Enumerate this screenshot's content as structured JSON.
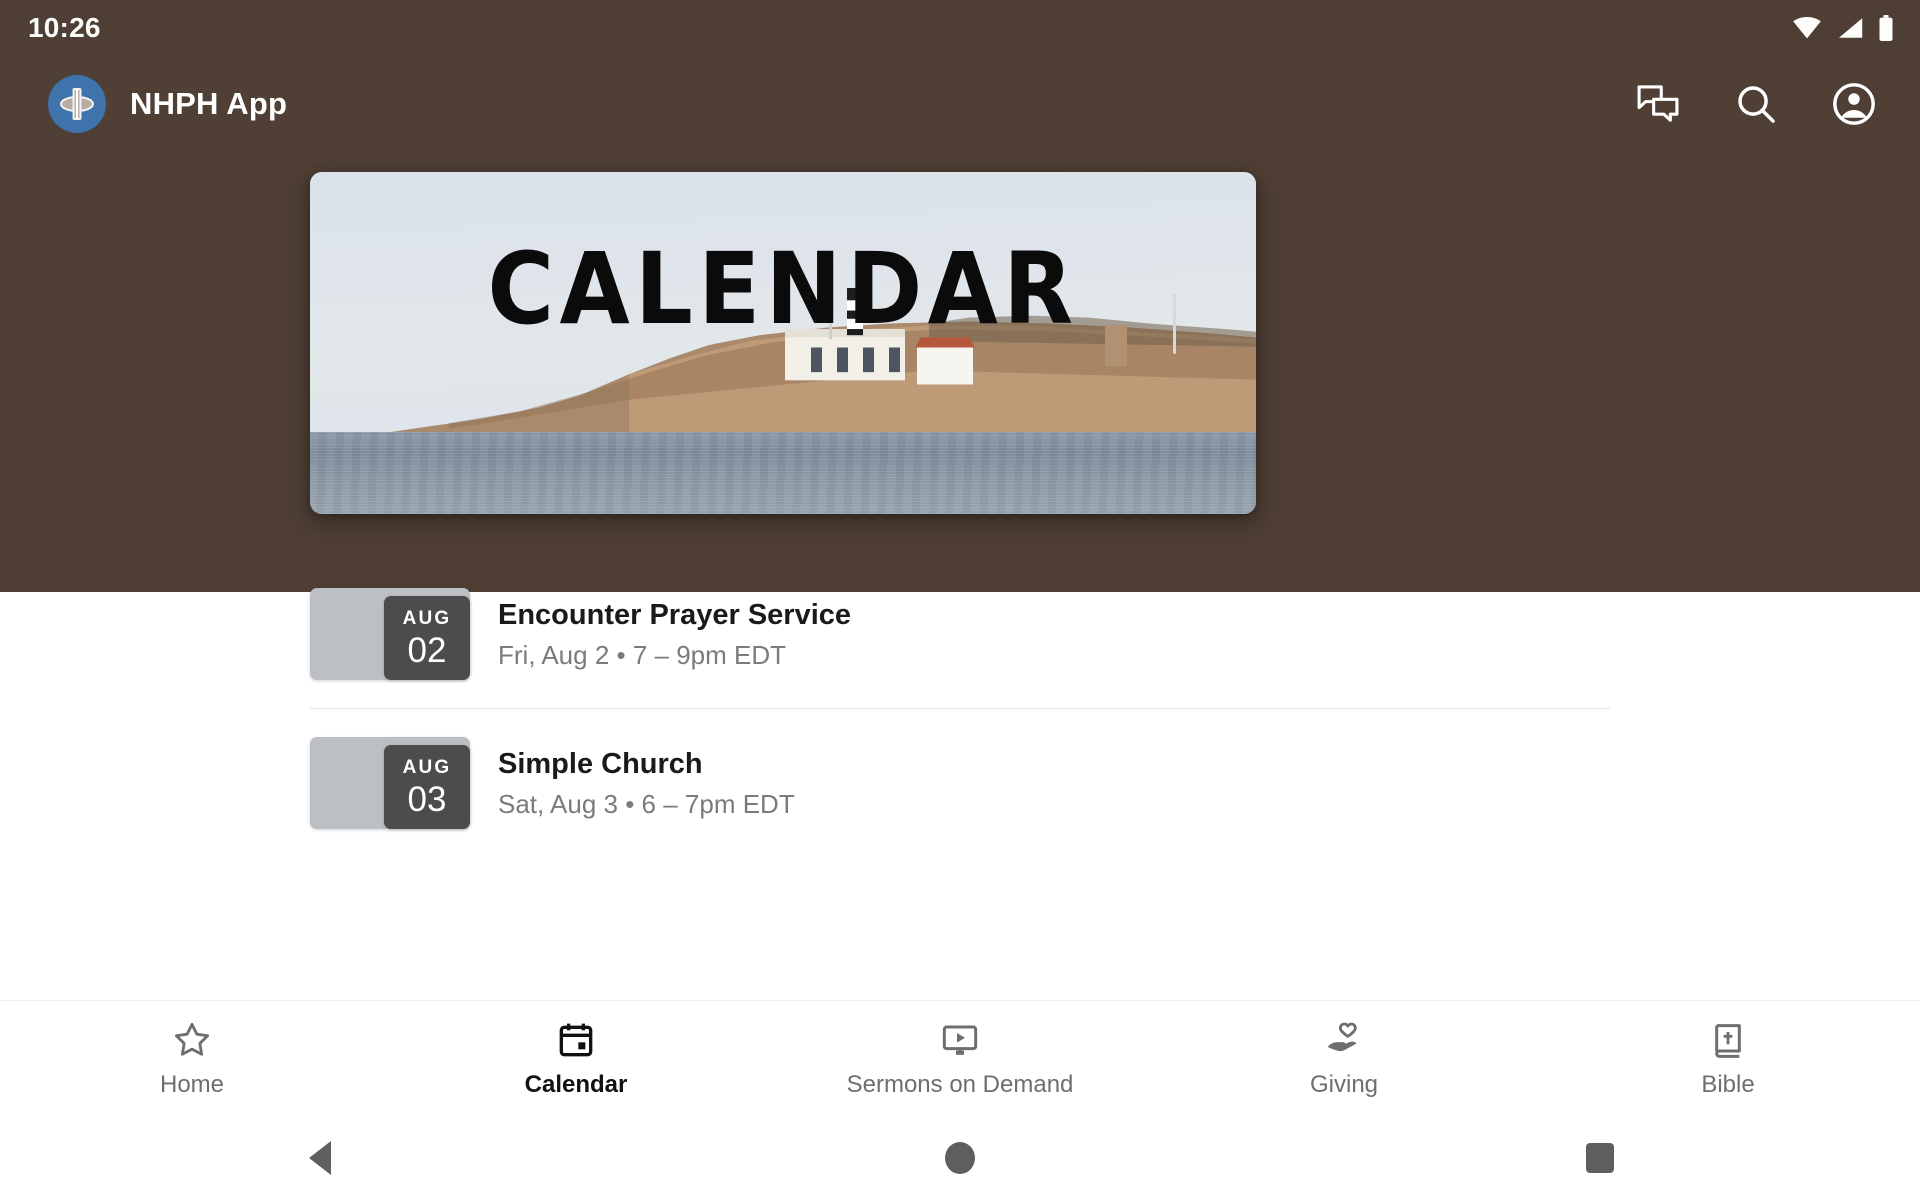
{
  "status_bar": {
    "time": "10:26",
    "icons": [
      "wifi-icon",
      "cellular-signal-icon",
      "battery-icon"
    ]
  },
  "app_bar": {
    "title": "NHPH App",
    "logo_icon": "church-cross-logo-icon",
    "logo_color": "#3e73ab",
    "background_color": "#4e3e34",
    "actions": [
      {
        "name": "chat-icon",
        "label": "Chat"
      },
      {
        "name": "search-icon",
        "label": "Search"
      },
      {
        "name": "account-circle-icon",
        "label": "Account"
      }
    ]
  },
  "hero": {
    "headline": "CALENDAR",
    "alt": "Coastal cliff with lighthouse buildings above the sea"
  },
  "events": [
    {
      "month": "AUG",
      "day": "02",
      "title": "Encounter Prayer Service",
      "meta": "Fri, Aug 2 • 7 – 9pm EDT"
    },
    {
      "month": "AUG",
      "day": "03",
      "title": "Simple Church",
      "meta": "Sat, Aug 3 • 6 – 7pm EDT"
    }
  ],
  "bottom_nav": {
    "active": "Calendar",
    "items": [
      {
        "label": "Home",
        "icon": "star-outline-icon",
        "active": false
      },
      {
        "label": "Calendar",
        "icon": "calendar-icon",
        "active": true
      },
      {
        "label": "Sermons on Demand",
        "icon": "video-monitor-play-icon",
        "active": false
      },
      {
        "label": "Giving",
        "icon": "hand-heart-icon",
        "active": false
      },
      {
        "label": "Bible",
        "icon": "bible-book-cross-icon",
        "active": false
      }
    ]
  },
  "system_nav": {
    "back": "back-triangle-icon",
    "home": "home-circle-icon",
    "recents": "recents-square-icon"
  }
}
